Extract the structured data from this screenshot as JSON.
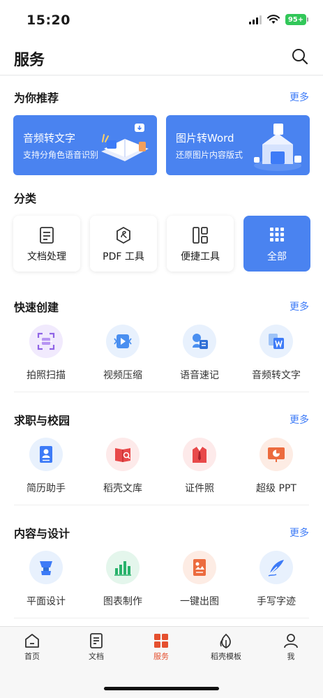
{
  "status": {
    "time": "15:20",
    "battery": "95+"
  },
  "header": {
    "title": "服务"
  },
  "recommend": {
    "title": "为你推荐",
    "more": "更多",
    "cards": [
      {
        "title": "音频转文字",
        "subtitle": "支持分角色语音识别"
      },
      {
        "title": "图片转Word",
        "subtitle": "还原图片内容版式"
      }
    ]
  },
  "categories": {
    "title": "分类",
    "items": [
      {
        "label": "文档处理",
        "icon": "document-icon"
      },
      {
        "label": "PDF 工具",
        "icon": "pdf-icon"
      },
      {
        "label": "便捷工具",
        "icon": "tools-icon"
      },
      {
        "label": "全部",
        "icon": "grid-dots-icon"
      }
    ]
  },
  "quick_create": {
    "title": "快速创建",
    "more": "更多",
    "items": [
      {
        "label": "拍照扫描",
        "icon": "scan-icon"
      },
      {
        "label": "视频压缩",
        "icon": "video-compress-icon"
      },
      {
        "label": "语音速记",
        "icon": "voice-note-icon"
      },
      {
        "label": "音频转文字",
        "icon": "audio-to-text-icon"
      }
    ]
  },
  "career": {
    "title": "求职与校园",
    "more": "更多",
    "items": [
      {
        "label": "简历助手",
        "icon": "resume-icon"
      },
      {
        "label": "稻壳文库",
        "icon": "library-icon"
      },
      {
        "label": "证件照",
        "icon": "id-photo-icon"
      },
      {
        "label": "超级 PPT",
        "icon": "ppt-icon"
      }
    ]
  },
  "design": {
    "title": "内容与设计",
    "more": "更多",
    "items": [
      {
        "label": "平面设计",
        "icon": "graphic-design-icon"
      },
      {
        "label": "图表制作",
        "icon": "chart-maker-icon"
      },
      {
        "label": "一键出图",
        "icon": "one-click-image-icon"
      },
      {
        "label": "手写字迹",
        "icon": "handwriting-icon"
      }
    ]
  },
  "tabbar": {
    "items": [
      {
        "label": "首页",
        "icon": "home-icon"
      },
      {
        "label": "文档",
        "icon": "document-icon"
      },
      {
        "label": "服务",
        "icon": "services-icon",
        "active": true
      },
      {
        "label": "稻壳模板",
        "icon": "leaf-icon"
      },
      {
        "label": "我",
        "icon": "profile-icon"
      }
    ]
  },
  "colors": {
    "accent": "#3d7bf7",
    "card_blue": "#4a83f0",
    "active_tab": "#e5502f"
  }
}
